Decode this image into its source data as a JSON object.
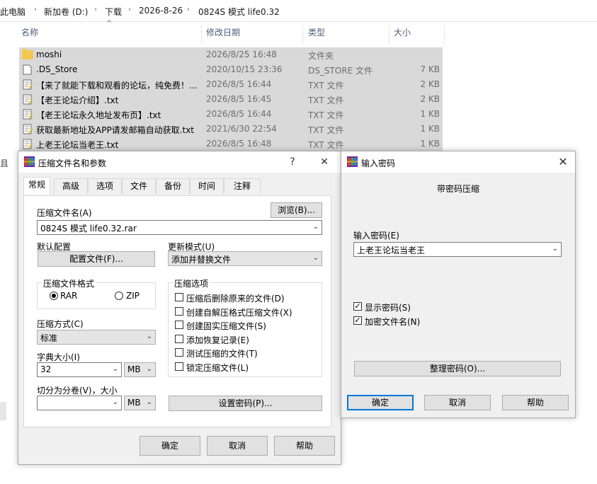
{
  "breadcrumb": [
    "此电脑",
    "新加卷 (D:)",
    "下载",
    "2026-8-26",
    "0824S 模式 life0.32"
  ],
  "columns": {
    "name": "名称",
    "date": "修改日期",
    "type": "类型",
    "size": "大小"
  },
  "files": [
    {
      "name": "moshi",
      "date": "2026/8/25 16:48",
      "type": "文件夹",
      "size": "",
      "icon": "folder-icon"
    },
    {
      "name": ".DS_Store",
      "date": "2020/10/15 23:36",
      "type": "DS_STORE 文件",
      "size": "7 KB",
      "icon": "file-icon"
    },
    {
      "name": "【来了就能下载和观看的论坛，纯免费！...",
      "date": "2026/8/5 16:44",
      "type": "TXT 文件",
      "size": "2 KB",
      "icon": "txt-icon"
    },
    {
      "name": "【老王论坛介绍】.txt",
      "date": "2026/8/5 16:45",
      "type": "TXT 文件",
      "size": "2 KB",
      "icon": "txt-icon"
    },
    {
      "name": "【老王论坛永久地址发布页】.txt",
      "date": "2026/8/5 16:44",
      "type": "TXT 文件",
      "size": "1 KB",
      "icon": "txt-icon"
    },
    {
      "name": "获取最新地址及APP请发邮箱自动获取.txt",
      "date": "2021/6/30 22:54",
      "type": "TXT 文件",
      "size": "1 KB",
      "icon": "txt-icon"
    },
    {
      "name": "上老王论坛当老王.txt",
      "date": "2026/8/5 16:48",
      "type": "TXT 文件",
      "size": "1 KB",
      "icon": "txt-icon"
    }
  ],
  "archive_dialog": {
    "title": "压缩文件名和参数",
    "help": "?",
    "close": "✕",
    "tabs": [
      "常规",
      "高级",
      "选项",
      "文件",
      "备份",
      "时间",
      "注释"
    ],
    "filename_label": "压缩文件名(A)",
    "browse": "浏览(B)...",
    "filename": "0824S 模式 life0.32.rar",
    "default_profile_label": "默认配置",
    "profiles_button": "配置文件(F)...",
    "update_mode_label": "更新模式(U)",
    "update_mode": "添加并替换文件",
    "format_label": "压缩文件格式",
    "format_rar": "RAR",
    "format_zip": "ZIP",
    "options_label": "压缩选项",
    "options": [
      {
        "label": "压缩后删除原来的文件(D)",
        "checked": false
      },
      {
        "label": "创建自解压格式压缩文件(X)",
        "checked": false
      },
      {
        "label": "创建固实压缩文件(S)",
        "checked": false
      },
      {
        "label": "添加恢复记录(E)",
        "checked": false
      },
      {
        "label": "测试压缩的文件(T)",
        "checked": false
      },
      {
        "label": "锁定压缩文件(L)",
        "checked": false
      }
    ],
    "method_label": "压缩方式(C)",
    "method": "标准",
    "dict_label": "字典大小(I)",
    "dict": "32",
    "dict_unit": "MB",
    "split_label": "切分为分卷(V)，大小",
    "split_value": "",
    "split_unit": "MB",
    "set_password": "设置密码(P)...",
    "ok": "确定",
    "cancel": "取消",
    "help_btn": "帮助"
  },
  "password_dialog": {
    "title": "输入密码",
    "close": "✕",
    "heading": "带密码压缩",
    "password_label": "输入密码(E)",
    "password": "上老王论坛当老王",
    "show_password": "显示密码(S)",
    "encrypt_names": "加密文件名(N)",
    "check": "✓",
    "organize": "整理密码(O)...",
    "ok": "确定",
    "cancel": "取消",
    "help_btn": "帮助"
  },
  "misc": {
    "sort_arrow": "^",
    "chevron": "⌄",
    "crumb_sep": "›",
    "left_glyph": "且"
  }
}
